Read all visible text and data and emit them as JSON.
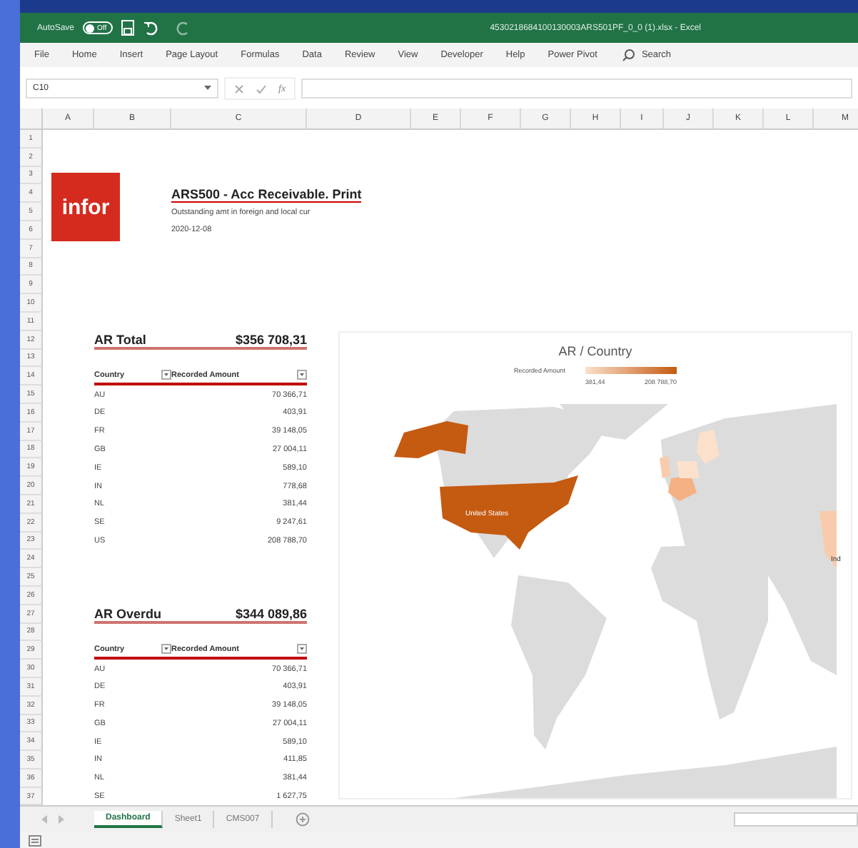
{
  "window": {
    "title": "4530218684100130003ARS501PF_0_0 (1).xlsx - Excel",
    "autosave": {
      "label": "AutoSave",
      "on": false,
      "state_label": "Off"
    }
  },
  "menu": [
    "File",
    "Home",
    "Insert",
    "Page Layout",
    "Formulas",
    "Data",
    "Review",
    "View",
    "Developer",
    "Help",
    "Power Pivot"
  ],
  "search": {
    "placeholder": "Search"
  },
  "formula_bar": {
    "name_box": "C10",
    "fx": "fx"
  },
  "columns": [
    "A",
    "B",
    "C",
    "D",
    "E",
    "F",
    "G",
    "H",
    "I",
    "J",
    "K",
    "L",
    "M"
  ],
  "rows": [
    "1",
    "2",
    "3",
    "4",
    "5",
    "6",
    "7",
    "8",
    "9",
    "10",
    "11",
    "12",
    "13",
    "14",
    "15",
    "16",
    "17",
    "18",
    "19",
    "20",
    "21",
    "22",
    "23",
    "24",
    "25",
    "26",
    "27",
    "28",
    "29",
    "30",
    "31",
    "32",
    "33",
    "34",
    "35",
    "36",
    "37"
  ],
  "report": {
    "logo": "infor",
    "title": "ARS500 - Acc Receivable. Print",
    "subtitle": "Outstanding amt in foreign and local cur",
    "date": "2020-12-08"
  },
  "tables": [
    {
      "label": "AR Total",
      "total": "$356 708,31",
      "columns": [
        "Country",
        "Recorded Amount"
      ],
      "rows": [
        [
          "AU",
          "70 366,71"
        ],
        [
          "DE",
          "403,91"
        ],
        [
          "FR",
          "39 148,05"
        ],
        [
          "GB",
          "27 004,11"
        ],
        [
          "IE",
          "589,10"
        ],
        [
          "IN",
          "778,68"
        ],
        [
          "NL",
          "381,44"
        ],
        [
          "SE",
          "9 247,61"
        ],
        [
          "US",
          "208 788,70"
        ]
      ]
    },
    {
      "label": "AR Overdu",
      "total": "$344 089,86",
      "columns": [
        "Country",
        "Recorded Amount"
      ],
      "rows": [
        [
          "AU",
          "70 366,71"
        ],
        [
          "DE",
          "403,91"
        ],
        [
          "FR",
          "39 148,05"
        ],
        [
          "GB",
          "27 004,11"
        ],
        [
          "IE",
          "589,10"
        ],
        [
          "IN",
          "411,85"
        ],
        [
          "NL",
          "381,44"
        ],
        [
          "SE",
          "1 627,75"
        ]
      ]
    }
  ],
  "chart": {
    "title": "AR / Country",
    "legend_label": "Recorded Amount",
    "legend_min": "381,44",
    "legend_max": "208 788,70",
    "map_labels": [
      "United States",
      "Ind"
    ]
  },
  "sheet_tabs": [
    {
      "label": "Dashboard",
      "selected": true
    },
    {
      "label": "Sheet1",
      "selected": false
    },
    {
      "label": "CMS007",
      "selected": false
    }
  ]
}
